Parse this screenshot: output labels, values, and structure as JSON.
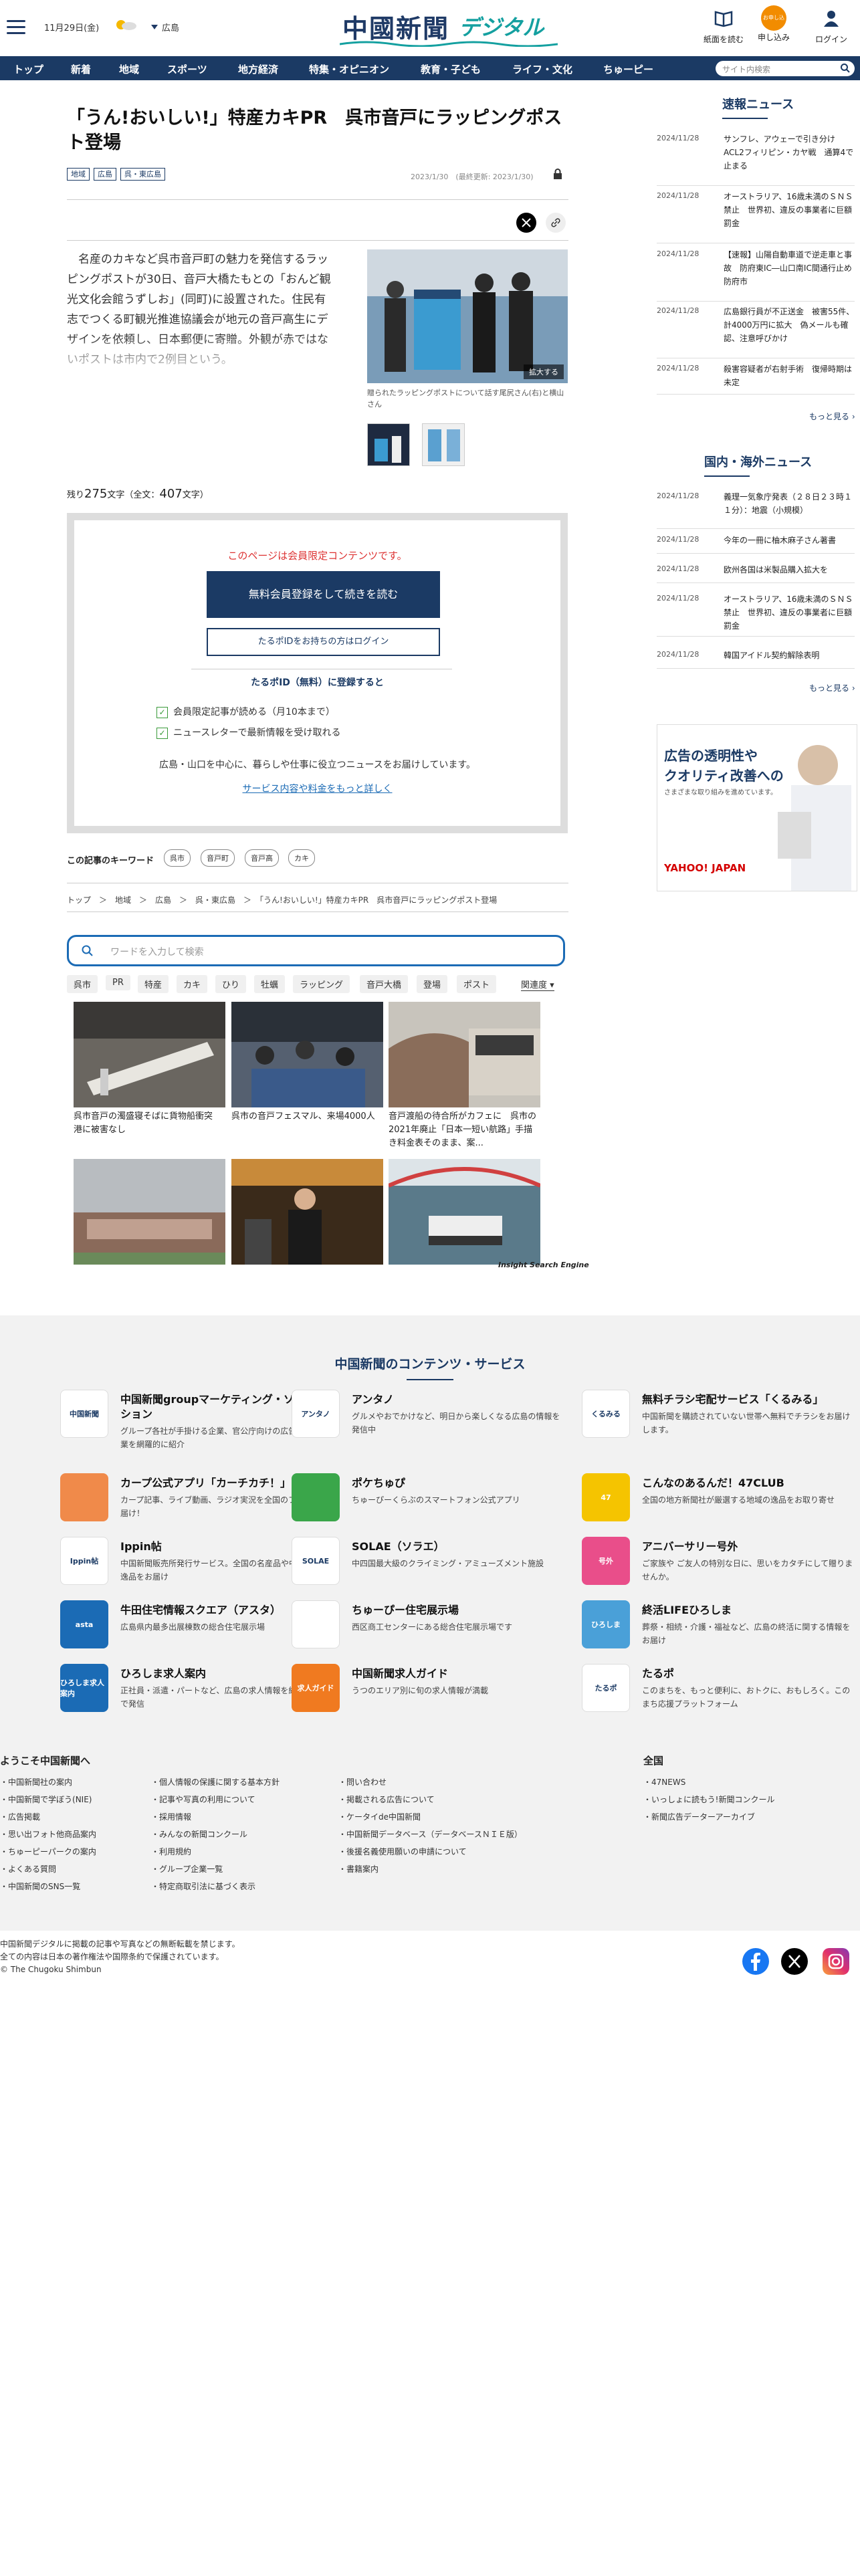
{
  "header": {
    "date": "11月29日(金)",
    "location": "広島",
    "logo_main": "中國新聞",
    "logo_sub": "デジタル",
    "icons": [
      {
        "name": "newspaper-icon",
        "label": "紙面を読む"
      },
      {
        "name": "subscribe-icon",
        "label": "申し込み"
      },
      {
        "name": "login-icon",
        "label": "ログイン"
      }
    ],
    "subscribe_badge": "お申し込み"
  },
  "nav": {
    "items": [
      "トップ",
      "新着",
      "地域",
      "スポーツ",
      "地方経済",
      "特集・オピニオン",
      "教育・子ども",
      "ライフ・文化",
      "ちゅーピー"
    ],
    "search_placeholder": "サイト内検索"
  },
  "article": {
    "title": "「うん!おいしい!」特産カキPR　呉市音戸にラッピングポスト登場",
    "tags": [
      "地域",
      "広島",
      "呉・東広島"
    ],
    "date": "2023/1/30　(最終更新: 2023/1/30)",
    "lead": "名産のカキなど呉市音戸町の魅力を発信するラッピングポストが30日、音戸大橋たもとの「おんど観光文化会館うずしお」(同町)に設置された。住民有志でつくる町観光推進協議会が地元の音戸高生にデザインを依頼し、日本郵便に寄贈。外観が赤ではないポストは市内で2例目という。",
    "photo_enlarge": "拡大する",
    "photo_caption": "贈られたラッピングポストについて話す尾尻さん(右)と横山さん",
    "remaining_prefix": "残り",
    "remaining": "275",
    "remaining_suffix": "文字（全文：",
    "total": "407",
    "total_suffix": "文字）"
  },
  "paywall": {
    "notice": "このページは会員限定コンテンツです。",
    "register_button": "無料会員登録をして続きを読む",
    "login_button": "たるポIDをお持ちの方はログイン",
    "id_heading": "たるポID（無料）に登録すると",
    "benefits": [
      "会員限定記事が読める（月10本まで）",
      "ニュースレターで最新情報を受け取れる"
    ],
    "note": "広島・山口を中心に、暮らしや仕事に役立つニュースをお届けしています。",
    "link": "サービス内容や料金をもっと詳しく"
  },
  "keywords": {
    "label": "この記事のキーワード",
    "items": [
      "呉市",
      "音戸町",
      "音戸高",
      "カキ"
    ]
  },
  "breadcrumb": "トップ　＞　地域　＞　広島　＞　呉・東広島　＞　「うん!おいしい!」特産カキPR　呉市音戸にラッピングポスト登場",
  "search_engine": {
    "placeholder": "ワードを入力して検索",
    "keywords": [
      "呉市",
      "PR",
      "特産",
      "カキ",
      "ひり",
      "牡蠣",
      "ラッピング",
      "音戸大橋",
      "登場",
      "ポスト"
    ],
    "sort": "関連度",
    "results": [
      {
        "caption": "呉市音戸の濁盛寝そばに貨物船衝突　港に被害なし"
      },
      {
        "caption": "呉市の音戸フェスマル、来場4000人"
      },
      {
        "caption": "音戸渡船の待合所がカフェに　呉市の2021年廃止「日本一短い航路」手描き料金表そのまま、案..."
      },
      {
        "caption": ""
      },
      {
        "caption": ""
      },
      {
        "caption": ""
      }
    ],
    "credit": "Insight Search Engine"
  },
  "sidebar": {
    "breaking_title": "速報ニュース",
    "breaking": [
      {
        "date": "2024/11/28",
        "text": "サンフレ、アウェーで引き分け　ACL2フィリピン・カヤ戦　通算4で止まる"
      },
      {
        "date": "2024/11/28",
        "text": "オーストラリア、16歳未満のＳＮＳ禁止　世界初、違反の事業者に巨額罰金"
      },
      {
        "date": "2024/11/28",
        "text": "【速報】山陽自動車道で逆走車と事故　防府東IC―山口南IC間通行止め防府市"
      },
      {
        "date": "2024/11/28",
        "text": "広島銀行員が不正送金　被害55件、計4000万円に拡大　偽メールも確認、注意呼びかけ"
      },
      {
        "date": "2024/11/28",
        "text": "殺害容疑者が右射手術　復帰時期は未定"
      }
    ],
    "more1": "もっと見る",
    "world_title": "国内・海外ニュース",
    "world": [
      {
        "date": "2024/11/28",
        "text": "義理一気象庁発表（２８日２３時１１分）：地震（小規模）"
      },
      {
        "date": "2024/11/28",
        "text": "今年の一冊に柚木麻子さん著書"
      },
      {
        "date": "2024/11/28",
        "text": "欧州各国は米製品購入拡大を"
      },
      {
        "date": "2024/11/28",
        "text": "オーストラリア、16歳未満のＳＮＳ禁止　世界初、違反の事業者に巨額罰金"
      },
      {
        "date": "2024/11/28",
        "text": "韓国アイドル契約解除表明"
      }
    ],
    "more2": "もっと見る",
    "ad": {
      "line1": "広告の透明性や",
      "line2": "クオリティ改善への",
      "line3": "さまざまな取り組みを進めています。",
      "brand": "YAHOO! JAPAN"
    }
  },
  "footer": {
    "heading": "中国新聞のコンテンツ・サービス",
    "services": [
      {
        "name": "中国新聞groupマーケティング・ソリューション",
        "desc": "グループ各社が手掛ける企業、官公庁向けの広告商品、事業を網羅的に紹介",
        "icon": "中国新聞",
        "color": "#ffffff"
      },
      {
        "name": "アンタノ",
        "desc": "グルメやおでかけなど、明日から楽しくなる広島の情報を発信中",
        "icon": "アンタノ",
        "color": "#ffffff"
      },
      {
        "name": "無料チラシ宅配サービス「くるみる」",
        "desc": "中国新聞を購読されていない世帯へ無料でチラシをお届けします。",
        "icon": "くるみる",
        "color": "#ffffff"
      },
      {
        "name": "カープ公式アプリ「カーチカチ！」",
        "desc": "カープ記事、ライブ動画、ラジオ実況を全国のファンにお届け！",
        "icon": "",
        "color": "#f08a4a"
      },
      {
        "name": "ポケちゅぴ",
        "desc": "ちゅーぴーくらぶのスマートフォン公式アプリ",
        "icon": "",
        "color": "#3aa64a"
      },
      {
        "name": "こんなのあるんだ！47CLUB",
        "desc": "全国の地方新聞社が厳選する地域の逸品をお取り寄せ",
        "icon": "47",
        "color": "#f5c400"
      },
      {
        "name": "Ippin帖",
        "desc": "中国新聞販売所発行サービス。全国の名産品や中国地方の逸品をお届け",
        "icon": "Ippin帖",
        "color": "#ffffff"
      },
      {
        "name": "SOLAE（ソラエ）",
        "desc": "中四国最大級のクライミング・アミューズメント施設",
        "icon": "SOLAE",
        "color": "#ffffff"
      },
      {
        "name": "アニバーサリー号外",
        "desc": "ご家族や ご友人の特別な日に、思いをカタチにして贈りませんか。",
        "icon": "号外",
        "color": "#e94e8a"
      },
      {
        "name": "牛田住宅情報スクエア（アスタ）",
        "desc": "広島県内最多出展棟数の総合住宅展示場",
        "icon": "asta",
        "color": "#1b6bb5"
      },
      {
        "name": "ちゅーぴー住宅展示場",
        "desc": "西区商工センターにある総合住宅展示場です",
        "icon": "",
        "color": "#ffffff"
      },
      {
        "name": "終活LIFEひろしま",
        "desc": "葬祭・相続・介護・福祉など、広島の終活に関する情報をお届け",
        "icon": "ひろしま",
        "color": "#4aa0d8"
      },
      {
        "name": "ひろしま求人案内",
        "desc": "正社員・派遣・パートなど、広島の求人情報を網羅とWebで発信",
        "icon": "ひろしま求人案内",
        "color": "#1b6bb5"
      },
      {
        "name": "中国新聞求人ガイド",
        "desc": "うつのエリア別に旬の求人情報が満載",
        "icon": "求人ガイド",
        "color": "#f07a20"
      },
      {
        "name": "たるポ",
        "desc": "このまちを、もっと便利に、おトクに、おもしろく。このまち応援プラットフォーム",
        "icon": "たるポ",
        "color": "#ffffff"
      }
    ],
    "welcome": "ようこそ中国新聞へ",
    "col1": [
      "中国新聞社の案内",
      "中国新聞で学ぼう(NIE)",
      "広告掲載",
      "思い出フォト他商品案内",
      "ちゅーピーパークの案内",
      "よくある質問",
      "中国新聞のSNS一覧"
    ],
    "col2": [
      "個人情報の保護に関する基本方針",
      "記事や写真の利用について",
      "採用情報",
      "みんなの新聞コンクール",
      "利用規約",
      "グループ企業一覧",
      "特定商取引法に基づく表示"
    ],
    "col3": [
      "問い合わせ",
      "掲載される広告について",
      "ケータイde中国新聞",
      "中国新聞データベース（データベースＮＩＥ版）",
      "後援名義使用願いの申請について",
      "書籍案内"
    ],
    "nation_title": "全国",
    "col4": [
      "47NEWS",
      "いっしょに読もう!新聞コンクール",
      "新聞広告データーアーカイブ"
    ],
    "copy1": "中国新聞デジタルに掲載の記事や写真などの無断転載を禁じます。",
    "copy2": "全ての内容は日本の著作権法や国際条約で保護されています。",
    "copy3": "© The Chugoku Shimbun"
  }
}
